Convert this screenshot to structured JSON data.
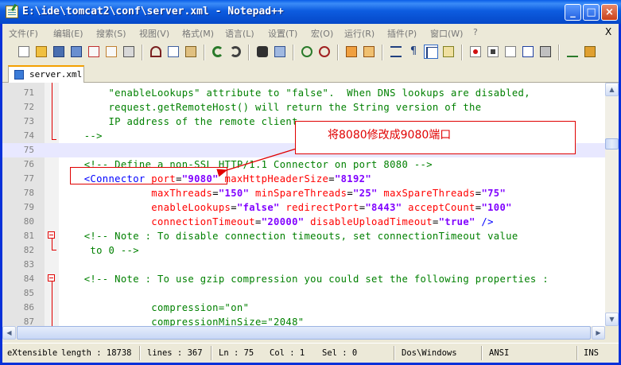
{
  "window": {
    "title": "E:\\ide\\tomcat2\\conf\\server.xml - Notepad++",
    "controls": {
      "minimize": "_",
      "maximize": "□",
      "close": "×"
    }
  },
  "menu": {
    "items": [
      {
        "label": "文件(F)"
      },
      {
        "label": "编辑(E)"
      },
      {
        "label": "搜索(S)"
      },
      {
        "label": "视图(V)"
      },
      {
        "label": "格式(M)"
      },
      {
        "label": "语言(L)"
      },
      {
        "label": "设置(T)"
      },
      {
        "label": "宏(O)"
      },
      {
        "label": "运行(R)"
      },
      {
        "label": "插件(P)"
      },
      {
        "label": "窗口(W)"
      },
      {
        "label": "?"
      }
    ],
    "close_label": "X"
  },
  "tabs": [
    {
      "label": "server.xml",
      "active": true
    }
  ],
  "editor": {
    "current_line": 75,
    "lines": [
      {
        "n": "71",
        "segments": [
          {
            "t": "        \"enableLookups\" attribute to \"false\".  When DNS lookups are disabled,",
            "c": "com"
          }
        ]
      },
      {
        "n": "72",
        "segments": [
          {
            "t": "        request.getRemoteHost() will return the String version of the",
            "c": "com"
          }
        ]
      },
      {
        "n": "73",
        "segments": [
          {
            "t": "        IP address of the remote client.",
            "c": "com"
          }
        ]
      },
      {
        "n": "74",
        "segments": [
          {
            "t": "    -->",
            "c": "com"
          }
        ]
      },
      {
        "n": "75",
        "segments": [
          {
            "t": "",
            "c": "txt"
          }
        ]
      },
      {
        "n": "76",
        "segments": [
          {
            "t": "    <!-- Define a non-SSL HTTP/1.1 Connector on port 8080 -->",
            "c": "com"
          }
        ]
      },
      {
        "n": "77",
        "segments": [
          {
            "t": "    ",
            "c": "txt"
          },
          {
            "t": "<Connector",
            "c": "tag"
          },
          {
            "t": " port",
            "c": "att"
          },
          {
            "t": "=",
            "c": "txt"
          },
          {
            "t": "\"9080\"",
            "c": "val"
          },
          {
            "t": " maxHttpHeaderSize",
            "c": "att"
          },
          {
            "t": "=",
            "c": "txt"
          },
          {
            "t": "\"8192\"",
            "c": "val"
          }
        ]
      },
      {
        "n": "78",
        "segments": [
          {
            "t": "               maxThreads",
            "c": "att"
          },
          {
            "t": "=",
            "c": "txt"
          },
          {
            "t": "\"150\"",
            "c": "val"
          },
          {
            "t": " minSpareThreads",
            "c": "att"
          },
          {
            "t": "=",
            "c": "txt"
          },
          {
            "t": "\"25\"",
            "c": "val"
          },
          {
            "t": " maxSpareThreads",
            "c": "att"
          },
          {
            "t": "=",
            "c": "txt"
          },
          {
            "t": "\"75\"",
            "c": "val"
          }
        ]
      },
      {
        "n": "79",
        "segments": [
          {
            "t": "               enableLookups",
            "c": "att"
          },
          {
            "t": "=",
            "c": "txt"
          },
          {
            "t": "\"false\"",
            "c": "val"
          },
          {
            "t": " redirectPort",
            "c": "att"
          },
          {
            "t": "=",
            "c": "txt"
          },
          {
            "t": "\"8443\"",
            "c": "val"
          },
          {
            "t": " acceptCount",
            "c": "att"
          },
          {
            "t": "=",
            "c": "txt"
          },
          {
            "t": "\"100\"",
            "c": "val"
          }
        ]
      },
      {
        "n": "80",
        "segments": [
          {
            "t": "               connectionTimeout",
            "c": "att"
          },
          {
            "t": "=",
            "c": "txt"
          },
          {
            "t": "\"20000\"",
            "c": "val"
          },
          {
            "t": " disableUploadTimeout",
            "c": "att"
          },
          {
            "t": "=",
            "c": "txt"
          },
          {
            "t": "\"true\"",
            "c": "val"
          },
          {
            "t": " />",
            "c": "tag"
          }
        ]
      },
      {
        "n": "81",
        "segments": [
          {
            "t": "    <!-- Note : To disable connection timeouts, set connectionTimeout value",
            "c": "com"
          }
        ]
      },
      {
        "n": "82",
        "segments": [
          {
            "t": "     to 0 -->",
            "c": "com"
          }
        ]
      },
      {
        "n": "83",
        "segments": [
          {
            "t": "",
            "c": "txt"
          }
        ]
      },
      {
        "n": "84",
        "segments": [
          {
            "t": "    <!-- Note : To use gzip compression you could set the following properties :",
            "c": "com"
          }
        ]
      },
      {
        "n": "85",
        "segments": [
          {
            "t": "",
            "c": "com"
          }
        ]
      },
      {
        "n": "86",
        "segments": [
          {
            "t": "               compression=\"on\"",
            "c": "com"
          }
        ]
      },
      {
        "n": "87",
        "segments": [
          {
            "t": "               compressionMinSize=\"2048\"",
            "c": "com"
          }
        ]
      }
    ]
  },
  "annotation": {
    "text": "将8080修改成9080端口"
  },
  "statusbar": {
    "type": "eXtensible",
    "length": "length : 18738",
    "lines": "lines : 367",
    "ln": "Ln : 75",
    "col": "Col : 1",
    "sel": "Sel : 0",
    "eol": "Dos\\Windows",
    "encoding": "ANSI",
    "mode": "INS"
  }
}
